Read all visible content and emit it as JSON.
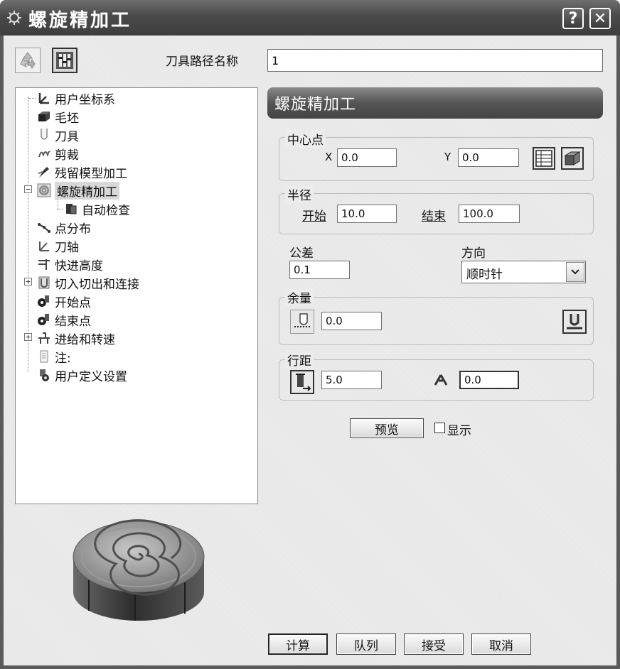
{
  "window": {
    "title": "螺旋精加工",
    "help_button": "?",
    "close_button": "✕"
  },
  "toolpath_name": {
    "label": "刀具路径名称",
    "value": "1"
  },
  "tree": {
    "items": [
      {
        "label": "用户坐标系",
        "icon": "workplane-icon"
      },
      {
        "label": "毛坯",
        "icon": "block-icon"
      },
      {
        "label": "刀具",
        "icon": "tool-icon"
      },
      {
        "label": "剪裁",
        "icon": "limit-icon"
      },
      {
        "label": "残留模型加工",
        "icon": "rest-model-icon"
      },
      {
        "label": "螺旋精加工",
        "icon": "spiral-finishing-icon",
        "expanded": true,
        "selected": true
      },
      {
        "label": "自动检查",
        "icon": "auto-verify-icon"
      },
      {
        "label": "点分布",
        "icon": "point-distribution-icon"
      },
      {
        "label": "刀轴",
        "icon": "tool-axis-icon"
      },
      {
        "label": "快进高度",
        "icon": "rapid-height-icon"
      },
      {
        "label": "切入切出和连接",
        "icon": "leads-links-icon",
        "expandable": true
      },
      {
        "label": "开始点",
        "icon": "start-point-icon"
      },
      {
        "label": "结束点",
        "icon": "end-point-icon"
      },
      {
        "label": "进给和转速",
        "icon": "feeds-speeds-icon",
        "expandable": true
      },
      {
        "label": "注:",
        "icon": "notes-icon"
      },
      {
        "label": "用户定义设置",
        "icon": "user-settings-icon"
      }
    ]
  },
  "panel": {
    "header": "螺旋精加工",
    "center": {
      "title": "中心点",
      "x_label": "X",
      "x_value": "0.0",
      "y_label": "Y",
      "y_value": "0.0"
    },
    "radius": {
      "title": "半径",
      "start_label": "开始",
      "start_value": "10.0",
      "end_label": "结束",
      "end_value": "100.0"
    },
    "tolerance": {
      "label": "公差",
      "value": "0.1"
    },
    "direction": {
      "label": "方向",
      "value": "顺时针"
    },
    "thickness": {
      "title": "余量",
      "value": "0.0"
    },
    "stepover": {
      "title": "行距",
      "value": "5.0",
      "stepdown_value": "0.0"
    },
    "preview_label": "预览",
    "show_label": "显示",
    "show_checked": false
  },
  "footer": {
    "calculate": "计算",
    "queue": "队列",
    "accept": "接受",
    "cancel": "取消"
  }
}
